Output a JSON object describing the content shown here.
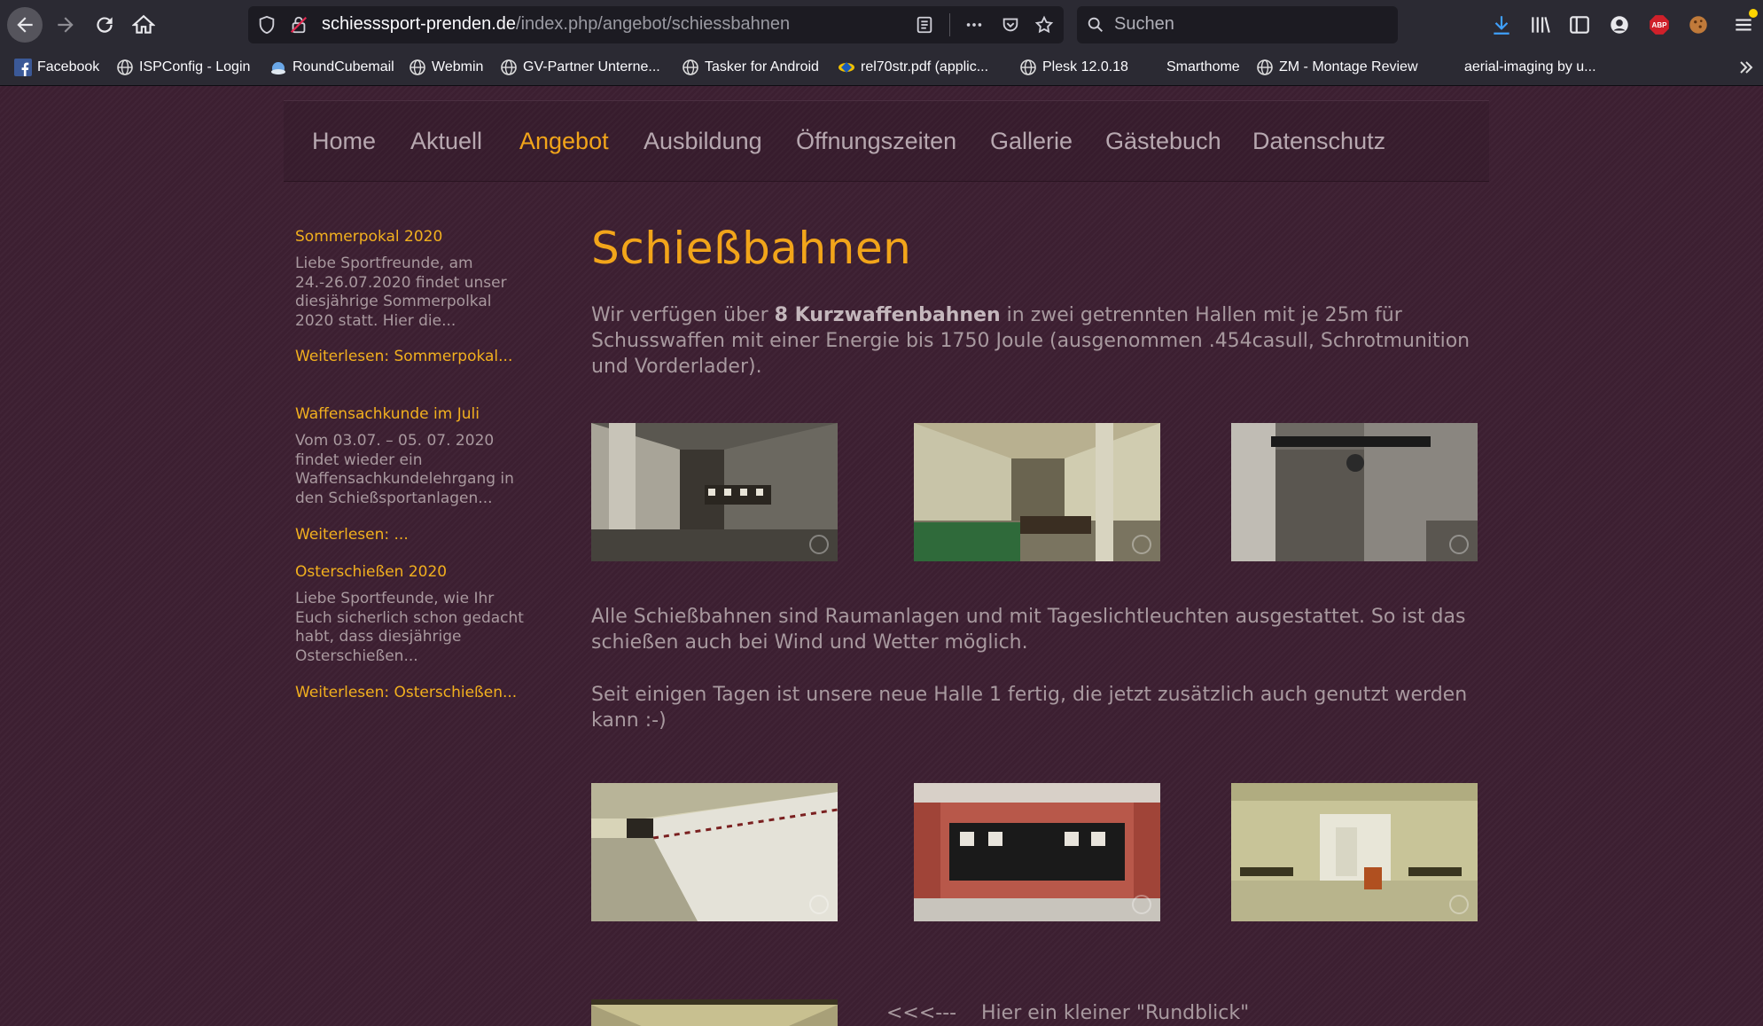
{
  "browser": {
    "url_host": "schiesssport-prenden.de",
    "url_path": "/index.php/angebot/schiessbahnen",
    "search_placeholder": "Suchen",
    "bookmarks": [
      {
        "label": "Facebook",
        "icon": "facebook-icon"
      },
      {
        "label": "ISPConfig - Login",
        "icon": "globe-icon"
      },
      {
        "label": "RoundCubemail",
        "icon": "roundcube-icon"
      },
      {
        "label": "Webmin",
        "icon": "globe-icon"
      },
      {
        "label": "GV-Partner Unterne...",
        "icon": "globe-icon"
      },
      {
        "label": "Tasker for Android",
        "icon": "globe-icon"
      },
      {
        "label": "rel70str.pdf (applic...",
        "icon": "pdf-icon"
      },
      {
        "label": "Plesk 12.0.18",
        "icon": "globe-icon"
      },
      {
        "label": "Smarthome",
        "icon": ""
      },
      {
        "label": "ZM - Montage Review",
        "icon": "globe-icon"
      },
      {
        "label": "aerial-imaging by u...",
        "icon": ""
      }
    ],
    "abp_label": "ABP"
  },
  "nav": {
    "items": [
      "Home",
      "Aktuell",
      "Angebot",
      "Ausbildung",
      "Öffnungszeiten",
      "Gallerie",
      "Gästebuch",
      "Datenschutz"
    ],
    "active": "Angebot"
  },
  "sidebar": {
    "posts": [
      {
        "title": "Sommerpokal 2020",
        "text": "Liebe Sportfreunde, am 24.-26.07.2020 findet unser diesjährige Sommerpolkal 2020 statt. Hier die...",
        "link": "Weiterlesen: Sommerpokal..."
      },
      {
        "title": "Waffensachkunde im Juli",
        "text": "Vom 03.07. – 05. 07. 2020 findet  wieder ein Waffensachkundelehrgang in den Schießsportanlagen...",
        "link": "Weiterlesen: ..."
      },
      {
        "title": "Osterschießen 2020",
        "text": "Liebe Sportfeunde, wie Ihr Euch sicherlich schon gedacht habt, dass diesjährige Osterschießen...",
        "link": "Weiterlesen: Osterschießen..."
      }
    ]
  },
  "main": {
    "title": "Schießbahnen",
    "intro_before": "Wir verfügen über ",
    "intro_bold": "8 Kurzwaffenbahnen",
    "intro_after": " in zwei getrennten Hallen mit je 25m für Schusswaffen mit einer Energie bis 1750 Joule (ausgenommen .454casull, Schrotmunition und Vorderlader).",
    "para2": "Alle Schießbahnen sind Raumanlagen und mit Tageslichtleuchten ausgestattet. So ist das schießen auch bei Wind und Wetter möglich.",
    "para3": "Seit einigen Tagen ist unsere neue Halle 1 fertig, die jetzt zusätzlich auch genutzt werden kann :-)",
    "rundblick_arrow": "<<<---",
    "rundblick_text": "Hier ein kleiner \"Rundblick\""
  },
  "colors": {
    "accent": "#f2a51a",
    "page_bg": "#3c1f31",
    "text": "#a8999f",
    "chrome": "#2b2a33"
  }
}
